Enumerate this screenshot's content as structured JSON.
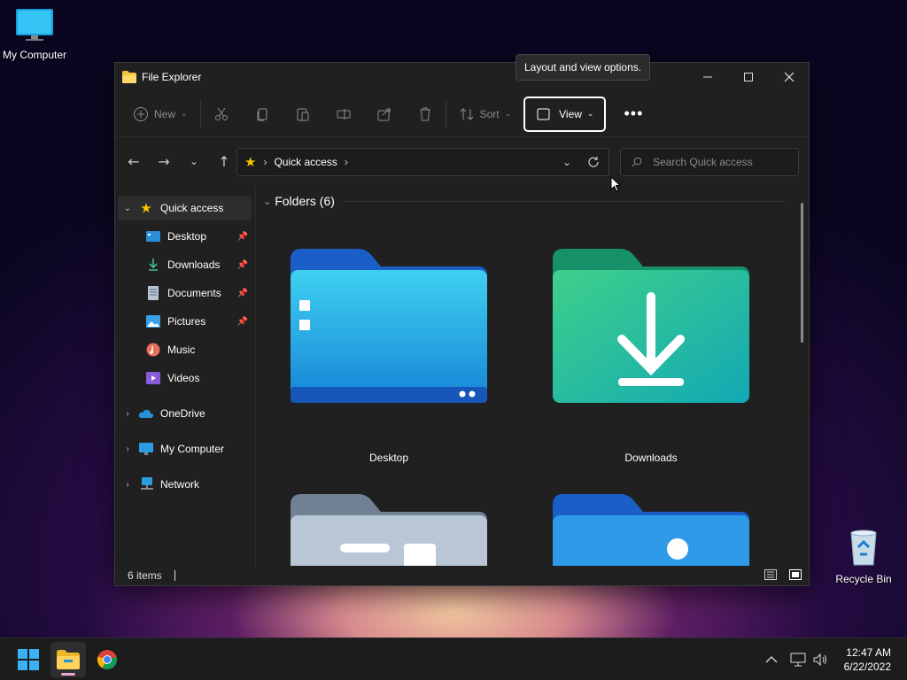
{
  "desktop": {
    "icons": [
      {
        "label": "My Computer"
      },
      {
        "label": "Recycle Bin"
      }
    ]
  },
  "window": {
    "title": "File Explorer",
    "tooltip": "Layout and view options.",
    "commandbar": {
      "new_label": "New",
      "sort_label": "Sort",
      "view_label": "View"
    },
    "address": {
      "path": "Quick access"
    },
    "search": {
      "placeholder": "Search Quick access"
    },
    "sidebar": {
      "items": [
        {
          "label": "Quick access"
        },
        {
          "label": "Desktop"
        },
        {
          "label": "Downloads"
        },
        {
          "label": "Documents"
        },
        {
          "label": "Pictures"
        },
        {
          "label": "Music"
        },
        {
          "label": "Videos"
        },
        {
          "label": "OneDrive"
        },
        {
          "label": "My Computer"
        },
        {
          "label": "Network"
        }
      ]
    },
    "content": {
      "section_title": "Folders (6)",
      "folders": [
        {
          "name": "Desktop"
        },
        {
          "name": "Downloads"
        }
      ]
    },
    "status": {
      "items_count": "6 items"
    }
  },
  "taskbar": {
    "time": "12:47 AM",
    "date": "6/22/2022"
  }
}
